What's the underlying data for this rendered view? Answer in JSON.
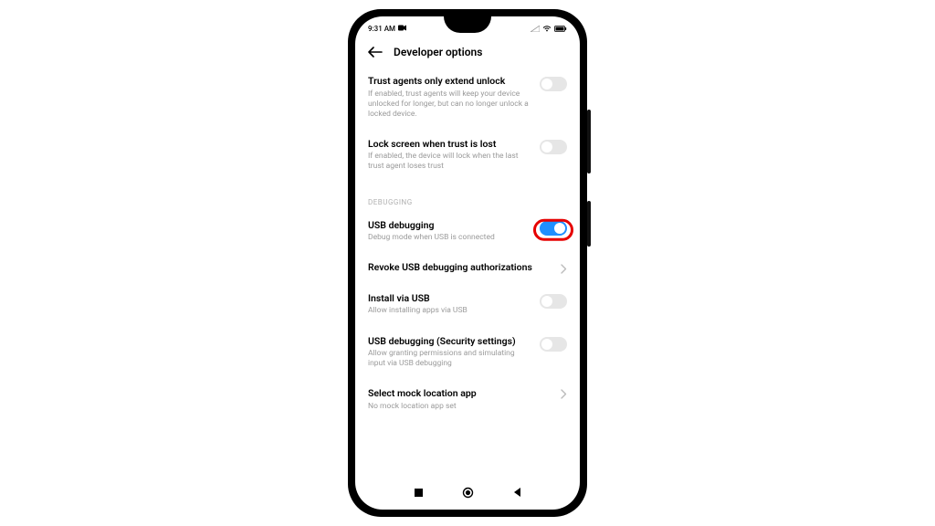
{
  "status": {
    "time": "9:31 AM"
  },
  "header": {
    "title": "Developer options"
  },
  "items": {
    "trust_agents": {
      "title": "Trust agents only extend unlock",
      "sub": "If enabled, trust agents will keep your device unlocked for longer, but can no longer unlock a locked device."
    },
    "lock_trust_lost": {
      "title": "Lock screen when trust is lost",
      "sub": "If enabled, the device will lock when the last trust agent loses trust"
    },
    "section_debugging": "DEBUGGING",
    "usb_debugging": {
      "title": "USB debugging",
      "sub": "Debug mode when USB is connected"
    },
    "revoke": {
      "title": "Revoke USB debugging authorizations"
    },
    "install_usb": {
      "title": "Install via USB",
      "sub": "Allow installing apps via USB"
    },
    "usb_debug_security": {
      "title": "USB debugging (Security settings)",
      "sub": "Allow granting permissions and simulating input via USB debugging"
    },
    "mock_location": {
      "title": "Select mock location app",
      "sub": "No mock location app set"
    }
  }
}
